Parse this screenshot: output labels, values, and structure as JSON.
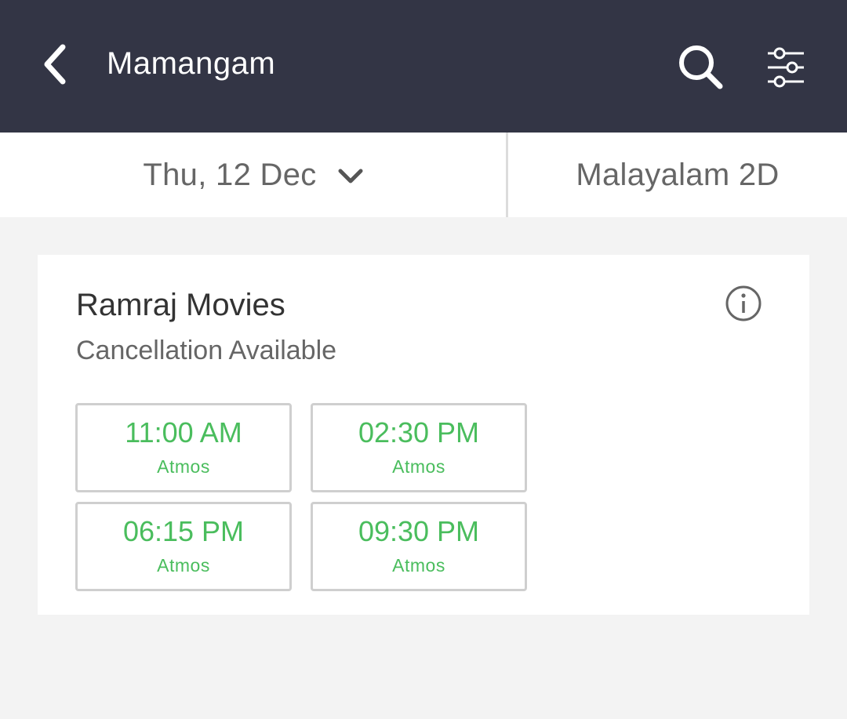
{
  "header": {
    "title": "Mamangam",
    "back_icon": "chevron-left-icon",
    "search_icon": "search-icon",
    "filter_icon": "sliders-icon",
    "background": "#333545"
  },
  "subheader": {
    "date": "Thu, 12 Dec",
    "date_icon": "chevron-down-icon",
    "format": "Malayalam 2D"
  },
  "theater": {
    "name": "Ramraj Movies",
    "cancellation": "Cancellation Available",
    "info_icon": "info-icon",
    "showtimes": [
      {
        "time": "11:00 AM",
        "sound": "Atmos"
      },
      {
        "time": "02:30 PM",
        "sound": "Atmos"
      },
      {
        "time": "06:15 PM",
        "sound": "Atmos"
      },
      {
        "time": "09:30 PM",
        "sound": "Atmos"
      }
    ]
  },
  "colors": {
    "available": "#4abd5d",
    "page_background": "#f3f3f3"
  }
}
